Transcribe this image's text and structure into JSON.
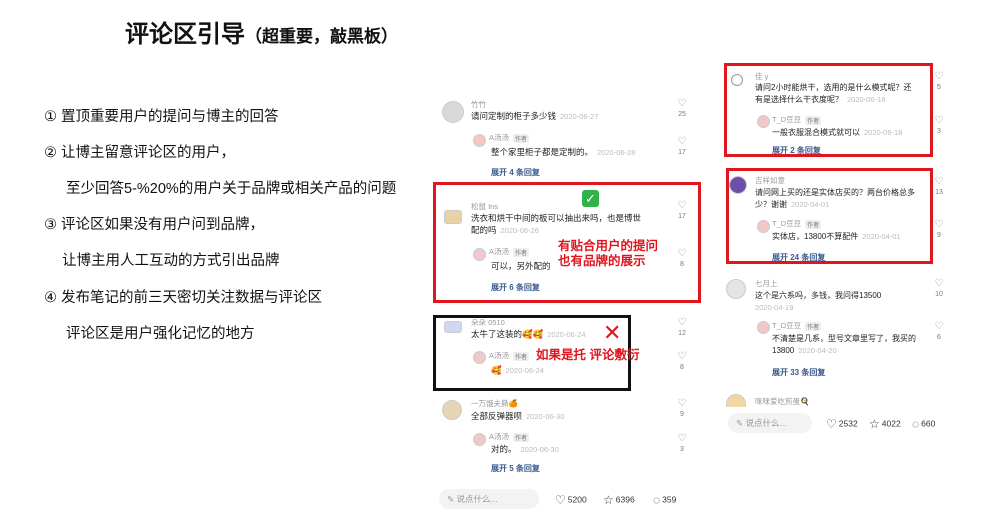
{
  "title": {
    "main": "评论区引导",
    "sub": "（超重要，敲黑板）"
  },
  "points": [
    "①  置顶重要用户的提问与博主的回答",
    "②  让博主留意评论区的用户，",
    "至少回答5-%20%的用户关于品牌或相关产品的问题",
    "③  评论区如果没有用户问到品牌，",
    "让博主用人工互动的方式引出品牌",
    "④  发布笔记的前三天密切关注数据与评论区",
    "评论区是用户强化记忆的地方"
  ],
  "left_phone": {
    "comments": [
      {
        "user": "竹竹",
        "text": "请问定制的柜子多少钱",
        "date": "2020-06-27",
        "likes": "25",
        "reply_user": "A汤汤",
        "reply_tag": "作者",
        "reply_text": "整个家里柜子都是定制的。",
        "reply_date": "2020-06-28",
        "reply_likes": "17",
        "expand": "展开 4 条回复"
      },
      {
        "user": "松鼠 Ins",
        "text": "洗衣和烘干中间的板可以抽出来吗，也是博世",
        "text2": "配的吗",
        "date": "2020-06-26",
        "likes": "17",
        "reply_user": "A汤汤",
        "reply_tag": "作者",
        "reply_text": "可以，另外配的",
        "reply_date": "",
        "reply_likes": "8",
        "expand": "展开 6 条回复"
      },
      {
        "user": "朵朵 0510",
        "text": "太牛了这装的🥰🥰",
        "date": "2020-06-24",
        "likes": "12",
        "reply_user": "A汤汤",
        "reply_tag": "作者",
        "reply_text": "🥰",
        "reply_date": "2020-06-24",
        "reply_likes": "8",
        "expand": ""
      },
      {
        "user": "一万饿夫撕🍊",
        "text": "全部反弹器呗",
        "date": "2020-06-30",
        "likes": "9",
        "reply_user": "A汤汤",
        "reply_tag": "作者",
        "reply_text": "对的。",
        "reply_date": "2020-06-30",
        "reply_likes": "3",
        "expand": "展开 5 条回复"
      }
    ],
    "annotation_good": "有贴合用户的提问也有品牌的展示",
    "annotation_bad": "如果是托 评论敷衍",
    "bar": {
      "placeholder": "说点什么...",
      "likes": "5200",
      "stars": "6396",
      "comments": "359"
    }
  },
  "right_phone": {
    "comments": [
      {
        "user": "佳 y",
        "text": "请问2小时能烘干，选用的是什么模式呢？还",
        "text2": "有是选择什么干衣度呢？",
        "date": "2020-06-18",
        "likes": "5",
        "reply_user": "T_D豆豆",
        "reply_tag": "作者",
        "reply_text": "一般衣服混合模式就可以",
        "reply_date": "2020-06-18",
        "reply_likes": "3",
        "expand": "展开 2 条回复"
      },
      {
        "user": "吉祥如意",
        "text": "请问网上买的还是实体店买的？两台价格总多",
        "text2": "少？谢谢",
        "date": "2020-04-01",
        "likes": "13",
        "reply_user": "T_D豆豆",
        "reply_tag": "作者",
        "reply_text": "实体店，13800不算配件",
        "reply_date": "2020-04-01",
        "reply_likes": "9",
        "expand": "展开 24 条回复"
      },
      {
        "user": "七月上",
        "text": "这个是六系吗，多钱，我问得13500",
        "text2": "",
        "date": "2020-04-19",
        "likes": "10",
        "reply_user": "T_D豆豆",
        "reply_tag": "作者",
        "reply_text": "不清楚是几系，型号文章里写了，我买的",
        "reply_text2": "13800",
        "reply_date": "2020-04-20",
        "reply_likes": "6",
        "expand": "展开 33 条回复"
      },
      {
        "user": "咪咪爱吃煎蛋🍳",
        "text": "",
        "date": "",
        "likes": ""
      }
    ],
    "bar": {
      "placeholder": "说点什么...",
      "likes": "2532",
      "stars": "4022",
      "comments": "660"
    }
  }
}
